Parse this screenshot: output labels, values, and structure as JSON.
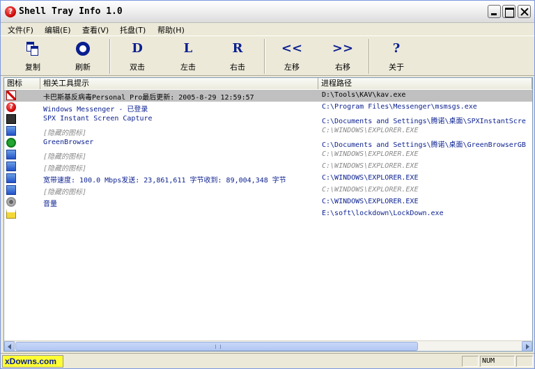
{
  "window": {
    "title": "Shell Tray Info 1.0",
    "icon": "question-red-icon"
  },
  "menu": [
    "文件(F)",
    "编辑(E)",
    "查看(V)",
    "托盘(T)",
    "帮助(H)"
  ],
  "toolbar": {
    "copy": "复制",
    "refresh": "刷新",
    "dbl_glyph": "D",
    "dbl": "双击",
    "left_glyph": "L",
    "left": "左击",
    "right_glyph": "R",
    "right": "右击",
    "moveleft_glyph": "<<",
    "moveleft": "左移",
    "moveright_glyph": ">>",
    "moveright": "右移",
    "about_glyph": "?",
    "about": "关于"
  },
  "columns": {
    "icon": "图标",
    "tip": "相关工具提示",
    "path": "进程路径"
  },
  "rows": [
    {
      "icon": "kav-icon",
      "tip": "卡巴斯基反病毒Personal Pro最后更新: 2005-8-29 12:59:57",
      "path": "D:\\Tools\\KAV\\kav.exe",
      "selected": true
    },
    {
      "icon": "messenger-icon",
      "tip": "Windows Messenger - 已登录",
      "path": "C:\\Program Files\\Messenger\\msmsgs.exe"
    },
    {
      "icon": "spx-capture-icon",
      "tip": " SPX Instant Screen Capture",
      "path": "C:\\Documents and Settings\\腾诺\\桌面\\SPXInstantScre"
    },
    {
      "icon": "explorer-icon",
      "tip": "[隐藏的图标]",
      "path": "C:\\WINDOWS\\EXPLORER.EXE",
      "hidden": true
    },
    {
      "icon": "greenbrowser-icon",
      "tip": "GreenBrowser",
      "path": "C:\\Documents and Settings\\腾诺\\桌面\\GreenBrowserGB"
    },
    {
      "icon": "explorer-icon",
      "tip": "[隐藏的图标]",
      "path": "C:\\WINDOWS\\EXPLORER.EXE",
      "hidden": true
    },
    {
      "icon": "explorer-icon",
      "tip": "[隐藏的图标]",
      "path": "C:\\WINDOWS\\EXPLORER.EXE",
      "hidden": true
    },
    {
      "icon": "network-icon",
      "tip": "宽带速度: 100.0 Mbps发送: 23,861,611 字节收到: 89,004,348 字节",
      "path": "C:\\WINDOWS\\EXPLORER.EXE"
    },
    {
      "icon": "explorer-icon",
      "tip": "[隐藏的图标]",
      "path": "C:\\WINDOWS\\EXPLORER.EXE",
      "hidden": true
    },
    {
      "icon": "volume-icon",
      "tip": "音量",
      "path": "C:\\WINDOWS\\EXPLORER.EXE"
    },
    {
      "icon": "lock-icon",
      "tip": "",
      "path": "E:\\soft\\lockdown\\LockDown.exe"
    }
  ],
  "status": {
    "brand": "xDowns.com",
    "panel1": "",
    "num": "NUM",
    "panel3": ""
  }
}
